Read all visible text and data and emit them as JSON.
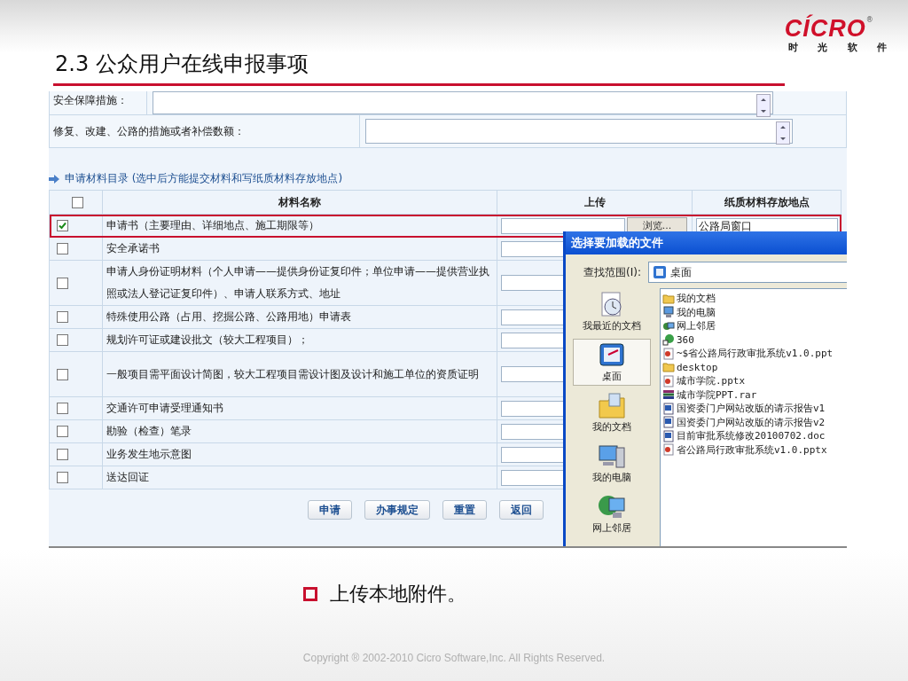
{
  "slide": {
    "title": "2.3 公众用户在线申报事项",
    "logo": {
      "mark": "CÍCRO",
      "registered": "®",
      "tagline": [
        "时",
        "光",
        "软",
        "件"
      ]
    }
  },
  "form": {
    "fields": [
      {
        "label": "安全保障措施："
      },
      {
        "label": "修复、改建、公路的措施或者补偿数额："
      }
    ]
  },
  "materials": {
    "heading": "申请材料目录 (选中后方能提交材料和写纸质材料存放地点)",
    "select_all_checked": false,
    "columns": [
      "材料名称",
      "上传",
      "纸质材料存放地点"
    ],
    "rows": [
      {
        "name": "申请书（主要理由、详细地点、施工期限等）",
        "checked": true,
        "highlighted": true,
        "browse": "浏览...",
        "location": "公路局窗口"
      },
      {
        "name": "安全承诺书",
        "checked": false,
        "highlighted": false
      },
      {
        "name": "申请人身份证明材料（个人申请——提供身份证复印件；单位申请——提供营业执照或法人登记证复印件）、申请人联系方式、地址",
        "checked": false,
        "highlighted": false
      },
      {
        "name": "特殊使用公路（占用、挖掘公路、公路用地）申请表",
        "checked": false,
        "highlighted": false
      },
      {
        "name": "规划许可证或建设批文（较大工程项目）；",
        "checked": false,
        "highlighted": false
      },
      {
        "name": "一般项目需平面设计简图，较大工程项目需设计图及设计和施工单位的资质证明",
        "checked": false,
        "highlighted": false
      },
      {
        "name": "交通许可申请受理通知书",
        "checked": false,
        "highlighted": false
      },
      {
        "name": "勘验（检查）笔录",
        "checked": false,
        "highlighted": false
      },
      {
        "name": "业务发生地示意图",
        "checked": false,
        "highlighted": false
      },
      {
        "name": "送达回证",
        "checked": false,
        "highlighted": false
      }
    ]
  },
  "buttons": [
    "申请",
    "办事规定",
    "重置",
    "返回"
  ],
  "dialog": {
    "title": "选择要加载的文件",
    "look_in_label": "查找范围(I):",
    "look_in_value": "桌面",
    "places": [
      {
        "label": "我最近的文档",
        "kind": "recent",
        "selected": false
      },
      {
        "label": "桌面",
        "kind": "desktop",
        "selected": true
      },
      {
        "label": "我的文档",
        "kind": "documents",
        "selected": false
      },
      {
        "label": "我的电脑",
        "kind": "computer",
        "selected": false
      },
      {
        "label": "网上邻居",
        "kind": "network",
        "selected": false
      }
    ],
    "files": [
      {
        "name": "我的文档",
        "kind": "folder"
      },
      {
        "name": "我的电脑",
        "kind": "computer"
      },
      {
        "name": "网上邻居",
        "kind": "network"
      },
      {
        "name": "360",
        "kind": "shortcut"
      },
      {
        "name": "~$省公路局行政审批系统v1.0.ppt",
        "kind": "ppt"
      },
      {
        "name": "desktop",
        "kind": "folder"
      },
      {
        "name": "城市学院.pptx",
        "kind": "ppt"
      },
      {
        "name": "城市学院PPT.rar",
        "kind": "rar"
      },
      {
        "name": "国资委门户网站改版的请示报告v1",
        "kind": "doc"
      },
      {
        "name": "国资委门户网站改版的请示报告v2",
        "kind": "doc"
      },
      {
        "name": "目前审批系统修改20100702.doc",
        "kind": "doc"
      },
      {
        "name": "省公路局行政审批系统v1.0.pptx",
        "kind": "ppt"
      }
    ]
  },
  "bullet": "上传本地附件。",
  "footer": "Copyright ® 2002-2010 Cicro Software,Inc. All Rights Reserved."
}
